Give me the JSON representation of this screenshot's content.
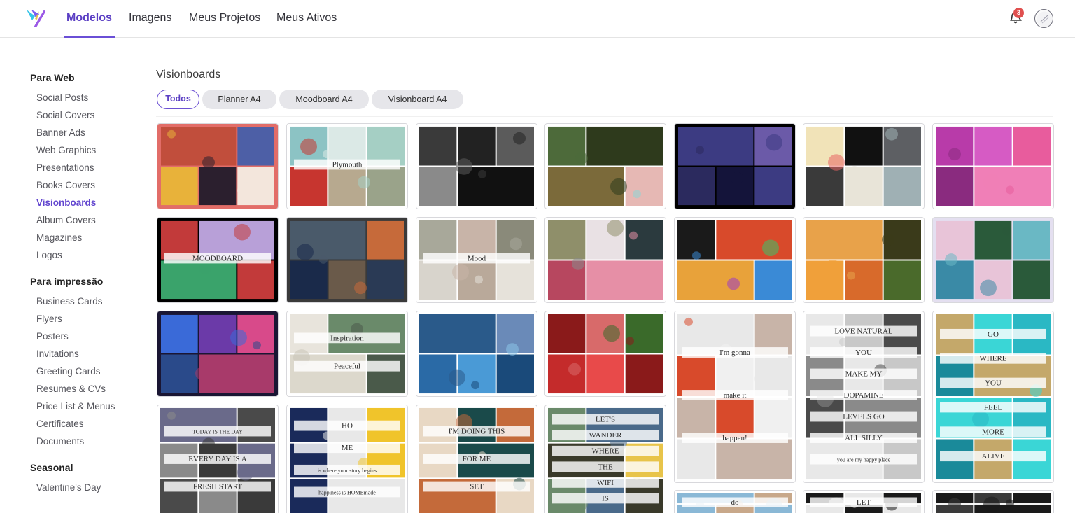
{
  "nav": {
    "items": [
      "Modelos",
      "Imagens",
      "Meus Projetos",
      "Meus Ativos"
    ],
    "active_index": 0,
    "notification_count": "3"
  },
  "sidebar": {
    "sections": [
      {
        "title": "Para Web",
        "items": [
          "Social Posts",
          "Social Covers",
          "Banner Ads",
          "Web Graphics",
          "Presentations",
          "Books Covers",
          "Visionboards",
          "Album Covers",
          "Magazines",
          "Logos"
        ]
      },
      {
        "title": "Para impressão",
        "items": [
          "Business Cards",
          "Flyers",
          "Posters",
          "Invitations",
          "Greeting Cards",
          "Resumes & CVs",
          "Price List & Menus",
          "Certificates",
          "Documents"
        ]
      },
      {
        "title": "Seasonal",
        "items": [
          "Valentine's Day"
        ]
      }
    ],
    "active_item": "Visionboards"
  },
  "main": {
    "title": "Visionboards",
    "filters": [
      "Todos",
      "Planner A4",
      "Moodboard A4",
      "Visionboard A4"
    ],
    "active_filter": 0
  },
  "templates": [
    {
      "col": 0,
      "bg": "#e26d68",
      "colors": [
        "#c14e3c",
        "#4d5fa6",
        "#e8b23a",
        "#2b1f2e",
        "#f3e6dc",
        "#7a9ad4"
      ],
      "texts": []
    },
    {
      "col": 1,
      "bg": "#ffffff",
      "colors": [
        "#9aa38a",
        "#8cc3c4",
        "#dbe9e6",
        "#a5cfc4",
        "#c7352f",
        "#b7a98f"
      ],
      "texts": [
        "Plymouth"
      ]
    },
    {
      "col": 2,
      "bg": "#ffffff",
      "colors": [
        "#111111",
        "#1c1c1c",
        "#3a3a3a",
        "#222222",
        "#5b5b5b",
        "#8a8a8a"
      ],
      "texts": []
    },
    {
      "col": 3,
      "bg": "#ffffff",
      "colors": [
        "#e9e08a",
        "#e95d5b",
        "#8ed6d6",
        "#4d6a3a",
        "#2e3a1c",
        "#7b6a3a",
        "#e6b8b4",
        "#f1e3b4",
        "#6b3a3a",
        "#3a1f1f"
      ],
      "texts": []
    },
    {
      "col": 4,
      "bg": "#000000",
      "colors": [
        "#3c3b82",
        "#6b5aa8",
        "#2b2a5e",
        "#14143a"
      ],
      "texts": []
    },
    {
      "col": 5,
      "bg": "#ffffff",
      "colors": [
        "#5d5f63",
        "#3a3a3a",
        "#e8e4d8",
        "#9fb0b4",
        "#e76462",
        "#f1e3b8",
        "#111111"
      ],
      "texts": []
    },
    {
      "col": 6,
      "bg": "#ffffff",
      "colors": [
        "#b83ba9",
        "#d65bc4",
        "#e85c9d",
        "#8a2b7f",
        "#f07fb7",
        "#c24ad0"
      ],
      "texts": []
    },
    {
      "col": 0,
      "bg": "#000000",
      "colors": [
        "#3aa36b",
        "#c23a3a",
        "#b8a0d8"
      ],
      "texts": [
        "MOODBOARD"
      ]
    },
    {
      "col": 1,
      "bg": "#3a3a3a",
      "colors": [
        "#2a3a55",
        "#1d2a44",
        "#4a5a6a",
        "#c66a3a",
        "#1a2a4a",
        "#6a5a4a"
      ],
      "texts": []
    },
    {
      "col": 2,
      "bg": "#ffffff",
      "colors": [
        "#d8d4cc",
        "#b9a99a",
        "#e6e2da",
        "#a8a89a",
        "#c8b4a8",
        "#8a8a7a"
      ],
      "texts": [
        "Mood"
      ]
    },
    {
      "col": 3,
      "bg": "#ffffff",
      "colors": [
        "#2b3a3e",
        "#b7475f",
        "#e68fa6",
        "#8a8a8a",
        "#8f8f6a",
        "#e9e1e4"
      ],
      "texts": []
    },
    {
      "col": 4,
      "bg": "#ffffff",
      "colors": [
        "#d84a2b",
        "#e8a23a",
        "#3a8ad6",
        "#9a3ac4",
        "#3ac46a",
        "#1a1a1a"
      ],
      "texts": []
    },
    {
      "col": 5,
      "bg": "#ffffff",
      "colors": [
        "#d86a2b",
        "#4a6a2b",
        "#e8a24a",
        "#3a3a1a",
        "#f0a03a"
      ],
      "texts": []
    },
    {
      "col": 6,
      "bg": "#e4dff0",
      "colors": [
        "#3a8aa6",
        "#e8c4d8",
        "#2a5a3a",
        "#6ab8c4"
      ],
      "texts": []
    },
    {
      "col": 0,
      "bg": "#1a1633",
      "colors": [
        "#6b3aa8",
        "#d84a8a",
        "#2a4a8a",
        "#a83a6a",
        "#3a6ad8"
      ],
      "texts": []
    },
    {
      "col": 1,
      "bg": "#ffffff",
      "colors": [
        "#e8e4dc",
        "#6a8a6a",
        "#dcd8cc",
        "#4a5a4a",
        "#c8c4b8"
      ],
      "texts": [
        "Inspiration",
        "Peaceful"
      ]
    },
    {
      "col": 2,
      "bg": "#ffffff",
      "colors": [
        "#2a6aa6",
        "#4a9ad6",
        "#1a4a7a",
        "#8ac4e8",
        "#2a5a8a",
        "#6a8ab8"
      ],
      "texts": []
    },
    {
      "col": 3,
      "bg": "#ffffff",
      "colors": [
        "#c42b2b",
        "#e84a4a",
        "#8a1a1a",
        "#d86a6a",
        "#3a6a2a"
      ],
      "texts": []
    }
  ],
  "tall_templates": [
    {
      "col": 4,
      "bg": "#ffffff",
      "colors": [
        "#e8e8e8",
        "#c8b4a8",
        "#d84a2b",
        "#f0f0f0"
      ],
      "texts": [
        "I'm gonna",
        "make it",
        "happen!"
      ]
    },
    {
      "col": 5,
      "bg": "#ffffff",
      "colors": [
        "#8a8a8a",
        "#e8e8e8",
        "#c8c8c8",
        "#4a4a4a"
      ],
      "texts": [
        "LOVE NATURAL",
        "YOU",
        "MAKE MY",
        "DOPAMINE",
        "LEVELS GO",
        "ALL SILLY",
        "you are my happy place"
      ]
    },
    {
      "col": 6,
      "bg": "#ffffff",
      "colors": [
        "#2ab8c4",
        "#1a8a9a",
        "#c4a86a",
        "#3ad6d6"
      ],
      "texts": [
        "GO",
        "WHERE",
        "YOU",
        "FEEL",
        "MORE",
        "ALIVE"
      ]
    }
  ],
  "bottom_templates": [
    {
      "col": 0,
      "bg": "#ffffff",
      "colors": [
        "#6a6a8a",
        "#4a4a4a",
        "#8a8a8a",
        "#3a3a3a"
      ],
      "texts": [
        "TODAY IS THE DAY",
        "EVERY DAY IS A",
        "FRESH START"
      ]
    },
    {
      "col": 1,
      "bg": "#ffffff",
      "colors": [
        "#f0c42b",
        "#1a2a5a",
        "#e8e8e8"
      ],
      "texts": [
        "HO",
        "ME",
        "is where your story begins",
        "happiness is HOMEmade"
      ]
    },
    {
      "col": 2,
      "bg": "#ffffff",
      "colors": [
        "#1a4a4a",
        "#c46a3a",
        "#e8d8c4"
      ],
      "texts": [
        "I'M DOING THIS",
        "FOR ME",
        "SET"
      ]
    },
    {
      "col": 3,
      "bg": "#ffffff",
      "colors": [
        "#4a6a8a",
        "#3a3a2a",
        "#e8c44a",
        "#6a8a6a"
      ],
      "texts": [
        "LET'S",
        "WANDER",
        "WHERE",
        "THE",
        "WIFI",
        "IS"
      ]
    },
    {
      "col": 4,
      "bg": "#ffffff",
      "colors": [
        "#8ab8d6",
        "#c8a88a"
      ],
      "texts": [
        "do"
      ]
    },
    {
      "col": 5,
      "bg": "#ffffff",
      "colors": [
        "#e8e8e8",
        "#1a1a1a"
      ],
      "texts": [
        "LET"
      ]
    },
    {
      "col": 6,
      "bg": "#ffffff",
      "colors": [
        "#1a1a1a",
        "#3a3a3a"
      ],
      "texts": []
    }
  ]
}
